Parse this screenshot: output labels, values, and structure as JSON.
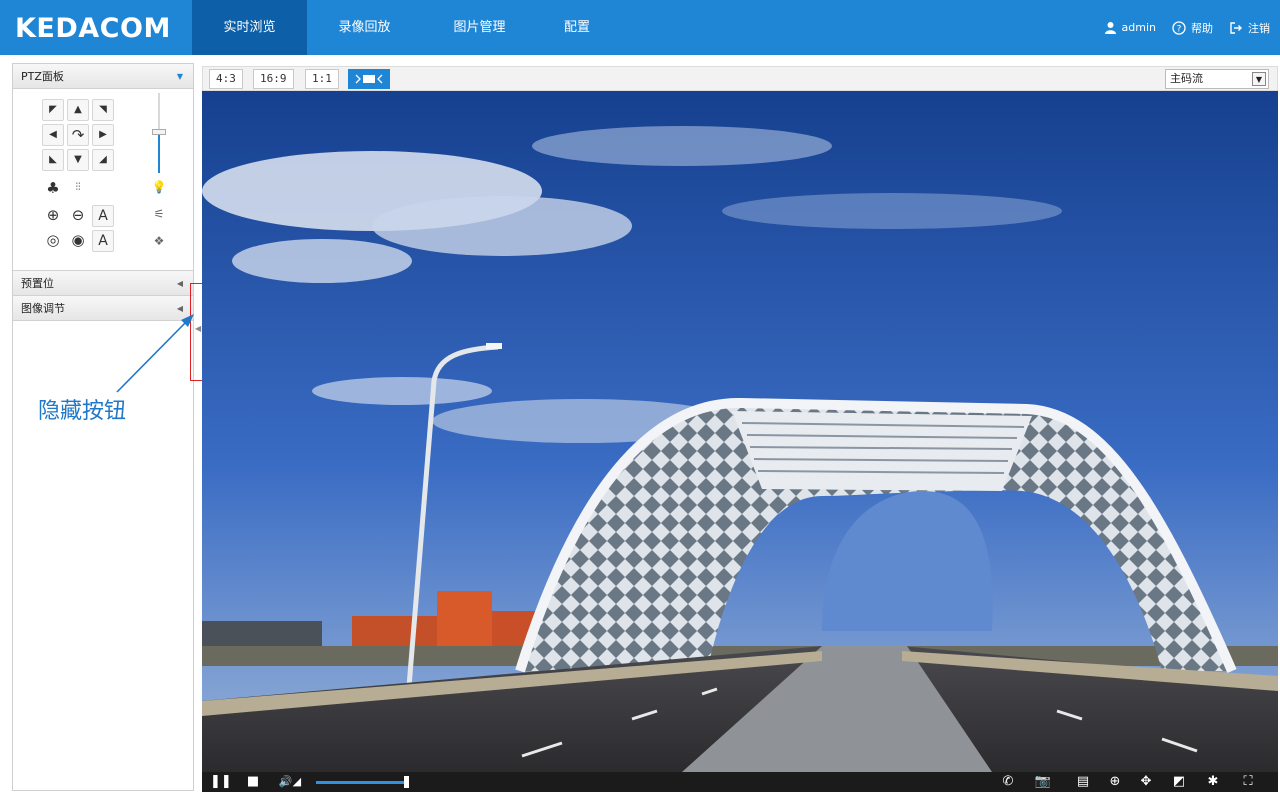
{
  "header": {
    "logo": "KEDACOM",
    "tabs": [
      {
        "label": "实时浏览",
        "active": true
      },
      {
        "label": "录像回放"
      },
      {
        "label": "图片管理"
      },
      {
        "label": "配置"
      }
    ],
    "user": {
      "name": "admin",
      "help": "帮助",
      "logout": "注销"
    }
  },
  "sidebar": {
    "ptz_panel": {
      "title": "PTZ面板"
    },
    "preset": {
      "title": "预置位"
    },
    "image_adjust": {
      "title": "图像调节"
    },
    "zoom_slider_level": 0.5
  },
  "annotation": {
    "text": "隐藏按钮"
  },
  "video_toolbar": {
    "ratios": [
      "4:3",
      "16:9",
      "1:1"
    ],
    "stream": "主码流"
  },
  "controls": {
    "volume_level": 0.95
  },
  "colors": {
    "brand": "#1f86d6",
    "active_tab": "#0d5fa8",
    "annotation": "#1f78c8",
    "highlight": "#e02020"
  }
}
